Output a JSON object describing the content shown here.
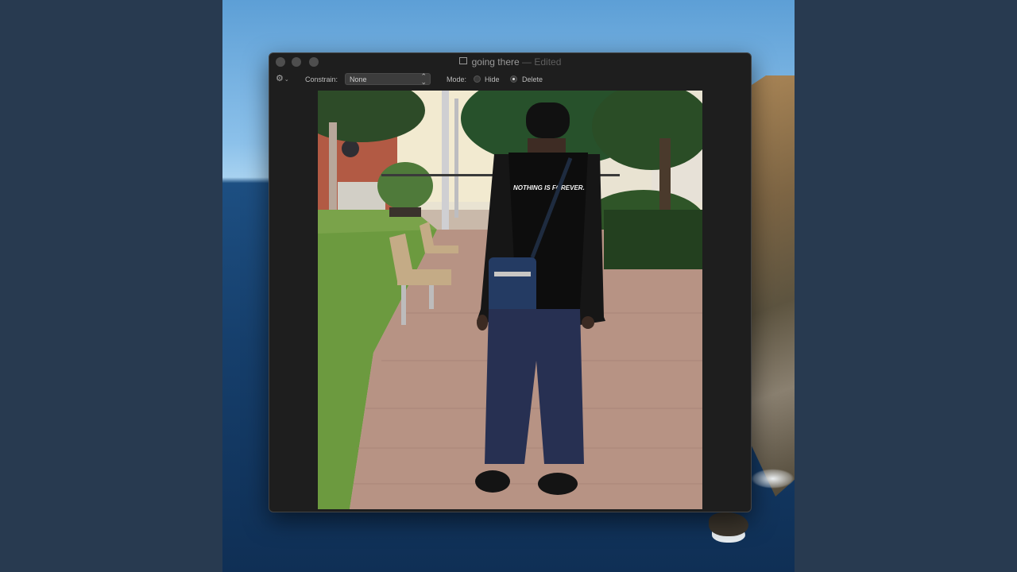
{
  "window": {
    "title": "going there",
    "edited": "Edited",
    "separator": "—"
  },
  "toolbar": {
    "gear_icon": "gear-icon",
    "constrain_label": "Constrain:",
    "constrain_value": "None",
    "mode_label": "Mode:",
    "mode_options": [
      "Hide",
      "Delete"
    ],
    "mode_selected": "Delete"
  },
  "photo": {
    "shirt_text": "NOTHING IS FOREVER."
  }
}
